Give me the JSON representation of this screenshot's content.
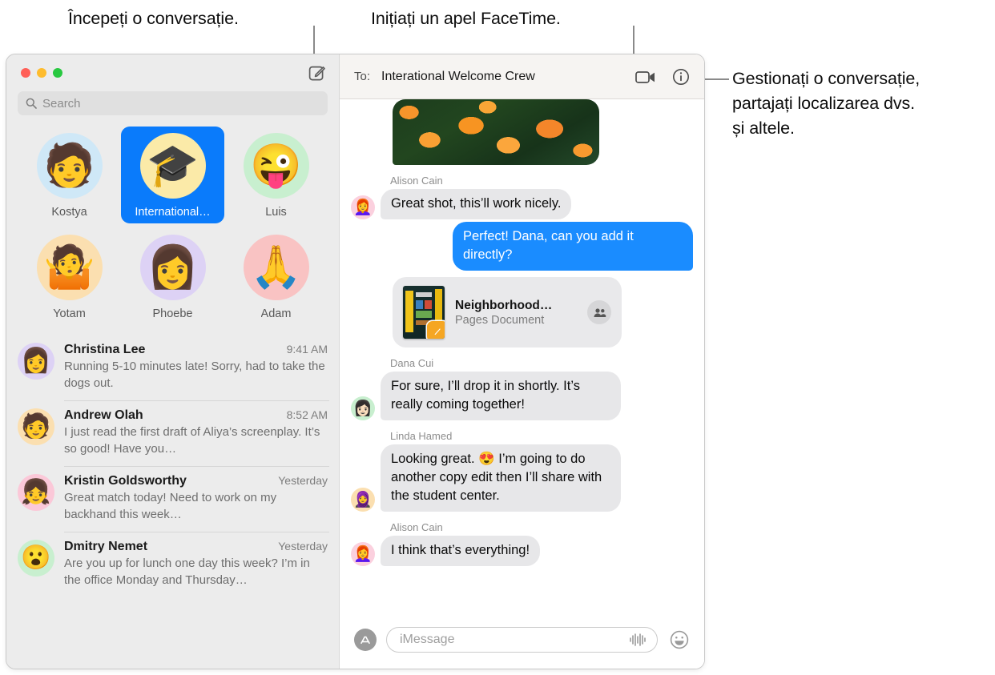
{
  "callouts": {
    "compose": "Începeți o conversație.",
    "facetime": "Inițiați un apel FaceTime.",
    "details": "Gestionați o conversație,\npartajați localizarea dvs.\nși altele."
  },
  "sidebar": {
    "search": {
      "placeholder": "Search",
      "icon": "search-icon"
    },
    "compose_icon": "compose-message-icon",
    "pinned": [
      {
        "label": "Kostya",
        "glyph": "🧑",
        "bg": "#cfe8f7",
        "selected": false
      },
      {
        "label": "International…",
        "glyph": "🎓",
        "bg": "#fbeaa8",
        "selected": true
      },
      {
        "label": "Luis",
        "glyph": "😜",
        "bg": "#c8efcf",
        "selected": false
      },
      {
        "label": "Yotam",
        "glyph": "🤷",
        "bg": "#fbdfb0",
        "selected": false
      },
      {
        "label": "Phoebe",
        "glyph": "👩",
        "bg": "#ddd2f5",
        "selected": false
      },
      {
        "label": "Adam",
        "glyph": "🙏",
        "bg": "#f9c3c3",
        "selected": false
      }
    ],
    "conversations": [
      {
        "name": "Christina Lee",
        "time": "9:41 AM",
        "preview": "Running 5-10 minutes late! Sorry, had to take the dogs out.",
        "glyph": "👩",
        "bg": "#ddd2f5"
      },
      {
        "name": "Andrew Olah",
        "time": "8:52 AM",
        "preview": "I just read the first draft of Aliya’s screenplay. It’s so good! Have you…",
        "glyph": "🧑",
        "bg": "#fbdfb0"
      },
      {
        "name": "Kristin Goldsworthy",
        "time": "Yesterday",
        "preview": "Great match today! Need to work on my backhand this week…",
        "glyph": "👧",
        "bg": "#fbc8d8"
      },
      {
        "name": "Dmitry Nemet",
        "time": "Yesterday",
        "preview": "Are you up for lunch one day this week? I’m in the office Monday and Thursday…",
        "glyph": "😮",
        "bg": "#c8efcf"
      }
    ]
  },
  "conversation": {
    "to_label": "To:",
    "to_value": "Interational Welcome Crew",
    "facetime_icon": "video-camera-icon",
    "details_icon": "info-icon",
    "photo_alt": "orange-flowers-photo",
    "messages": [
      {
        "kind": "photo",
        "name": "photo-attachment"
      },
      {
        "kind": "in",
        "sender": "Alison Cain",
        "text": "Great shot, this’ll work nicely.",
        "glyph": "👩‍🦰",
        "bg": "#fbd0de"
      },
      {
        "kind": "out",
        "sender": "",
        "text": "Perfect! Dana, can you add it directly?"
      },
      {
        "kind": "doc",
        "title": "Neighborhood…",
        "subtitle": "Pages Document",
        "people_icon": "shared-people-icon"
      },
      {
        "kind": "in",
        "sender": "Dana Cui",
        "text": "For sure, I’ll drop it in shortly. It’s really coming together!",
        "glyph": "👩🏻",
        "bg": "#c8efcf"
      },
      {
        "kind": "in",
        "sender": "Linda Hamed",
        "text": "Looking great. 😍 I’m going to do another copy edit then I’ll share with the student center.",
        "glyph": "🧕",
        "bg": "#fbdfb0"
      },
      {
        "kind": "in",
        "sender": "Alison Cain",
        "text": "I think that’s everything!",
        "glyph": "👩‍🦰",
        "bg": "#fbd0de"
      }
    ],
    "compose": {
      "apps_icon": "app-store-icon",
      "placeholder": "iMessage",
      "audio_icon": "audio-waveform-icon",
      "emoji_icon": "emoji-smiley-icon"
    }
  },
  "colors": {
    "accent_blue": "#0a7bfb",
    "bubble_out": "#1a8cff",
    "bubble_in": "#e7e7e9",
    "sidebar_bg": "#ececec",
    "header_bg": "#f6f4f2"
  }
}
